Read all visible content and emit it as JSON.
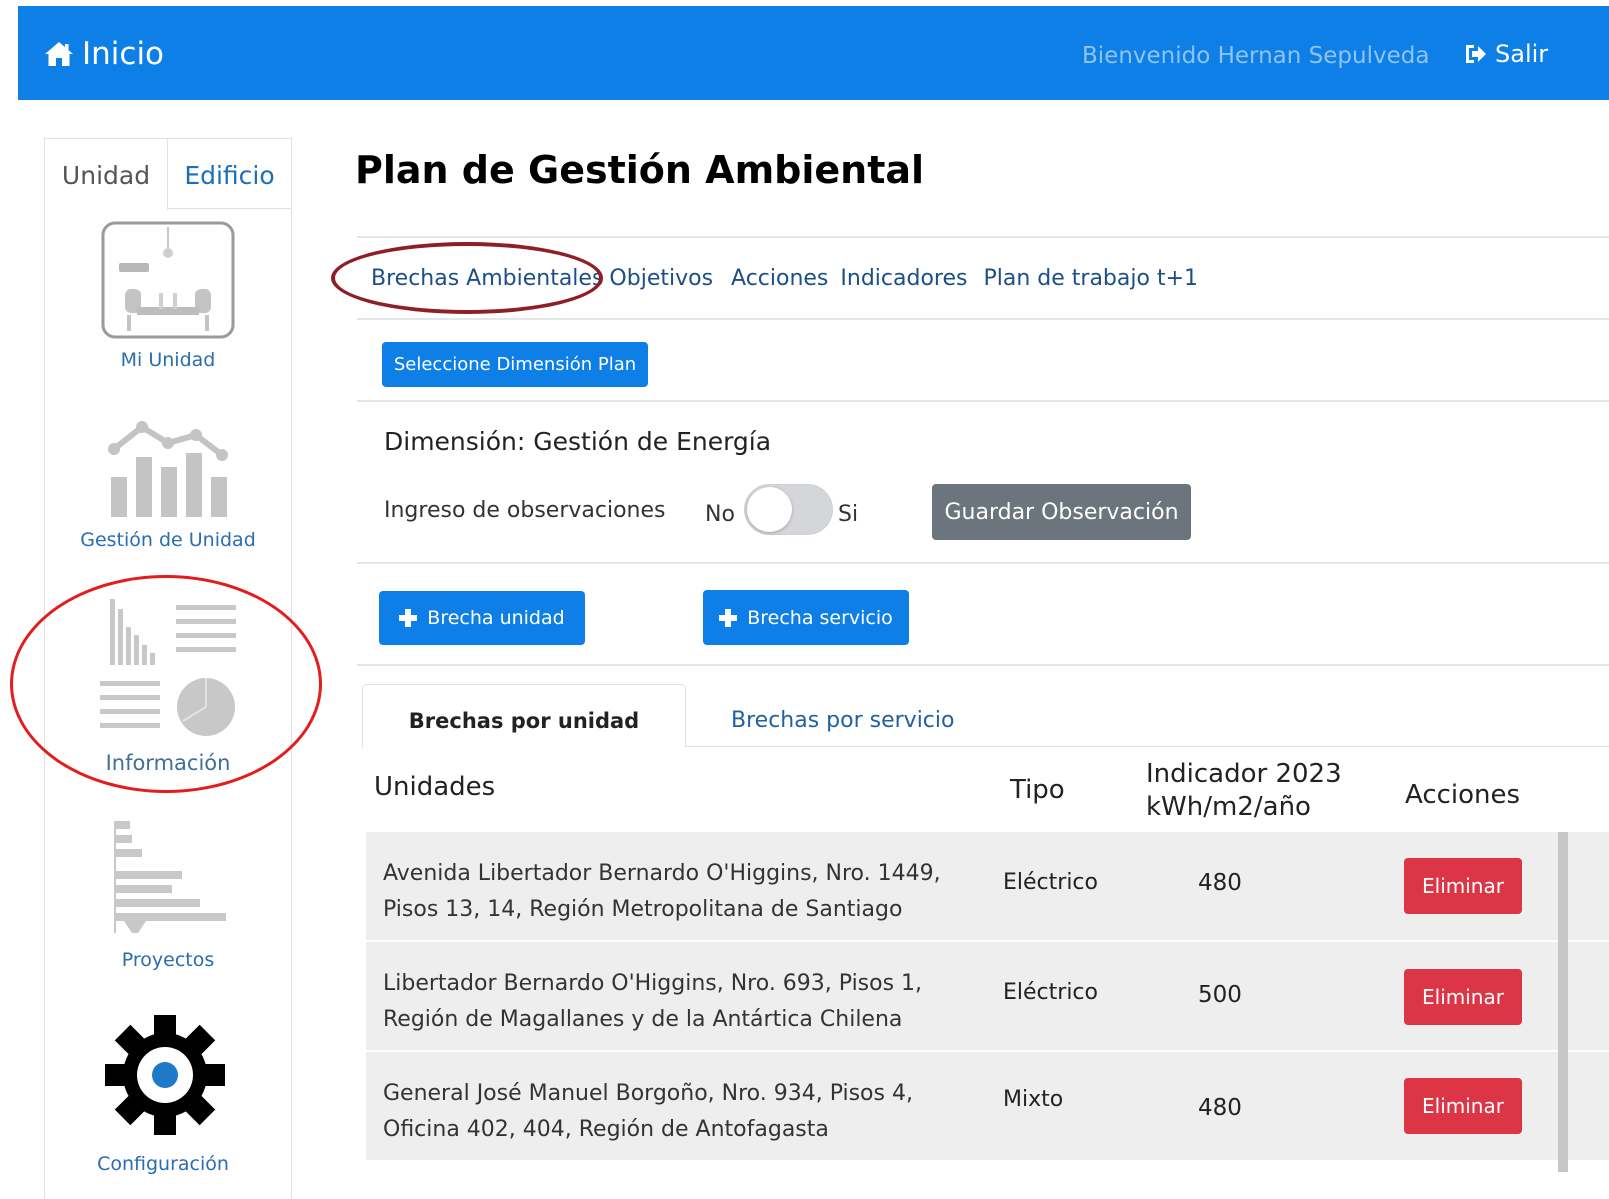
{
  "navbar": {
    "home_label": "Inicio",
    "welcome_text": "Bienvenido Hernan Sepulveda",
    "logout_label": "Salir"
  },
  "sidebar": {
    "tabs": [
      {
        "label": "Unidad"
      },
      {
        "label": "Edificio"
      }
    ],
    "items": [
      {
        "label": "Mi Unidad",
        "icon": "meeting-room-icon"
      },
      {
        "label": "Gestión de Unidad",
        "icon": "bar-line-chart-icon"
      },
      {
        "label": "Información",
        "icon": "info-charts-icon"
      },
      {
        "label": "Proyectos",
        "icon": "gantt-chart-icon"
      },
      {
        "label": "Configuración",
        "icon": "gear-icon"
      }
    ]
  },
  "main": {
    "title": "Plan de Gestión Ambiental",
    "subnav": [
      "Brechas Ambientales",
      "Objetivos",
      "Acciones",
      "Indicadores",
      "Plan de trabajo t+1"
    ],
    "select_dimension_label": "Seleccione Dimensión Plan",
    "dimension_title": "Dimensión: Gestión de Energía",
    "observations": {
      "label": "Ingreso de observaciones",
      "no_label": "No",
      "yes_label": "Si",
      "toggle_on": false,
      "save_label": "Guardar Observación"
    },
    "add_unit_gap_label": "Brecha unidad",
    "add_service_gap_label": "Brecha servicio",
    "tabs": [
      {
        "label": "Brechas por unidad",
        "active": true
      },
      {
        "label": "Brechas por servicio",
        "active": false
      }
    ],
    "table": {
      "headers": {
        "unidades": "Unidades",
        "tipo": "Tipo",
        "indicador_line1": "Indicador 2023",
        "indicador_line2": "kWh/m2/año",
        "acciones": "Acciones"
      },
      "rows": [
        {
          "addr_line1": "Avenida Libertador Bernardo O'Higgins, Nro. 1449,",
          "addr_line2": "Pisos 13, 14, Región Metropolitana de Santiago",
          "tipo": "Eléctrico",
          "indicador": "480",
          "action": "Eliminar"
        },
        {
          "addr_line1": "Libertador Bernardo O'Higgins, Nro. 693, Pisos 1,",
          "addr_line2": "Región de Magallanes y de la Antártica Chilena",
          "tipo": "Eléctrico",
          "indicador": "500",
          "action": "Eliminar"
        },
        {
          "addr_line1": "General José Manuel Borgoño, Nro. 934, Pisos 4,",
          "addr_line2": "Oficina 402, 404, Región de Antofagasta",
          "tipo": "Mixto",
          "indicador": "480",
          "action": "Eliminar"
        }
      ]
    }
  },
  "colors": {
    "primary": "#0d7fe6",
    "danger": "#dc3545",
    "secondary": "#6c757d",
    "annotation_red": "#e31d1d",
    "annotation_dark_red": "#8e1f26"
  }
}
